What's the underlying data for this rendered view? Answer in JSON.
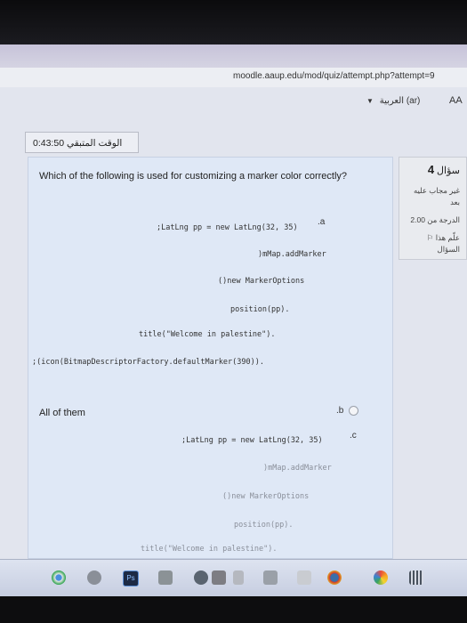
{
  "browser": {
    "url": "moodle.aaup.edu/mod/quiz/attempt.php?attempt=9"
  },
  "header": {
    "language_label": "العربية (ar)",
    "aa_label": "AA"
  },
  "timer": {
    "text": "0:43:50 الوقت المتبقي"
  },
  "question_info": {
    "label": "سؤال",
    "number": "4",
    "status_line1": "غير مجاب عليه",
    "status_line2": "بعد",
    "mark_text": "الدرجة من 2.00",
    "flag_line1": "علّم هذا",
    "flag_line2": "السؤال"
  },
  "question": {
    "text": "Which of the following is used for customizing a marker color correctly?",
    "options": [
      {
        "letter": ".a",
        "code": [
          ";LatLng pp = new LatLng(32, 35)",
          ")mMap.addMarker",
          "()new MarkerOptions",
          "position(pp).",
          "title(\"Welcome in palestine\").",
          ";(icon(BitmapDescriptorFactory.defaultMarker(390))."
        ]
      },
      {
        "letter": ".b",
        "text": "All of them"
      },
      {
        "letter": ".c",
        "code": [
          ";LatLng pp = new LatLng(32, 35)",
          ")mMap.addMarker",
          "()new MarkerOptions",
          "position(pp).",
          "title(\"Welcome in palestine\")."
        ]
      }
    ]
  },
  "taskbar": {
    "icons": [
      "chrome-icon",
      "photos-icon",
      "photoshop-icon",
      "gallery-icon",
      "maps-icon",
      "files-icon",
      "document-icon",
      "calculator-icon",
      "store-icon",
      "color-app-icon",
      "pinwheel-icon",
      "calendar-icon"
    ],
    "ps_label": "Ps"
  }
}
